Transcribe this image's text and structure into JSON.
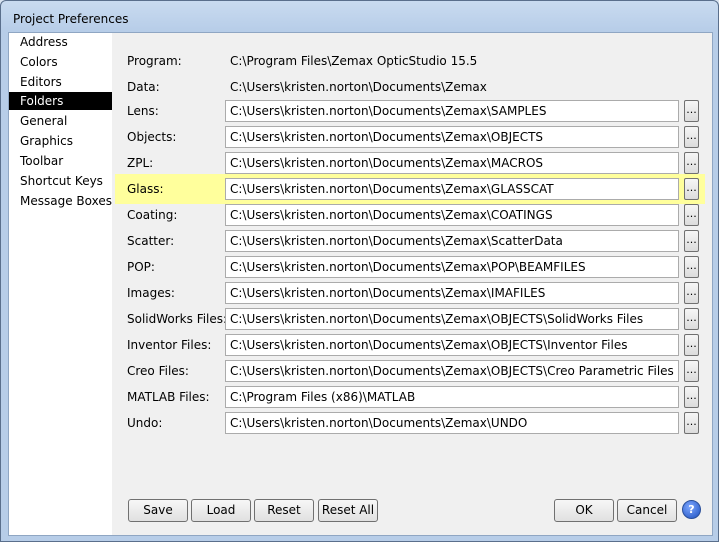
{
  "window": {
    "title": "Project Preferences"
  },
  "sidebar": {
    "items": [
      {
        "label": "Address"
      },
      {
        "label": "Colors"
      },
      {
        "label": "Editors"
      },
      {
        "label": "Folders"
      },
      {
        "label": "General"
      },
      {
        "label": "Graphics"
      },
      {
        "label": "Toolbar"
      },
      {
        "label": "Shortcut Keys"
      },
      {
        "label": "Message Boxes"
      }
    ],
    "active": "Folders"
  },
  "folders": {
    "program": {
      "label": "Program:",
      "value": "C:\\Program Files\\Zemax OpticStudio 15.5"
    },
    "data": {
      "label": "Data:",
      "value": "C:\\Users\\kristen.norton\\Documents\\Zemax"
    },
    "rows": [
      {
        "label": "Lens:",
        "value": "C:\\Users\\kristen.norton\\Documents\\Zemax\\SAMPLES"
      },
      {
        "label": "Objects:",
        "value": "C:\\Users\\kristen.norton\\Documents\\Zemax\\OBJECTS"
      },
      {
        "label": "ZPL:",
        "value": "C:\\Users\\kristen.norton\\Documents\\Zemax\\MACROS"
      },
      {
        "label": "Glass:",
        "value": "C:\\Users\\kristen.norton\\Documents\\Zemax\\GLASSCAT"
      },
      {
        "label": "Coating:",
        "value": "C:\\Users\\kristen.norton\\Documents\\Zemax\\COATINGS"
      },
      {
        "label": "Scatter:",
        "value": "C:\\Users\\kristen.norton\\Documents\\Zemax\\ScatterData"
      },
      {
        "label": "POP:",
        "value": "C:\\Users\\kristen.norton\\Documents\\Zemax\\POP\\BEAMFILES"
      },
      {
        "label": "Images:",
        "value": "C:\\Users\\kristen.norton\\Documents\\Zemax\\IMAFILES"
      },
      {
        "label": "SolidWorks Files:",
        "value": "C:\\Users\\kristen.norton\\Documents\\Zemax\\OBJECTS\\SolidWorks Files"
      },
      {
        "label": "Inventor Files:",
        "value": "C:\\Users\\kristen.norton\\Documents\\Zemax\\OBJECTS\\Inventor Files"
      },
      {
        "label": "Creo Files:",
        "value": "C:\\Users\\kristen.norton\\Documents\\Zemax\\OBJECTS\\Creo Parametric Files"
      },
      {
        "label": "MATLAB Files:",
        "value": "C:\\Program Files (x86)\\MATLAB"
      },
      {
        "label": "Undo:",
        "value": "C:\\Users\\kristen.norton\\Documents\\Zemax\\UNDO"
      }
    ],
    "highlighted_row": "Glass:",
    "highlight_color": "#ffff9c",
    "browse_label": "..."
  },
  "buttons": {
    "save": "Save",
    "load": "Load",
    "reset": "Reset",
    "reset_all": "Reset All",
    "ok": "OK",
    "cancel": "Cancel",
    "help": "?"
  }
}
